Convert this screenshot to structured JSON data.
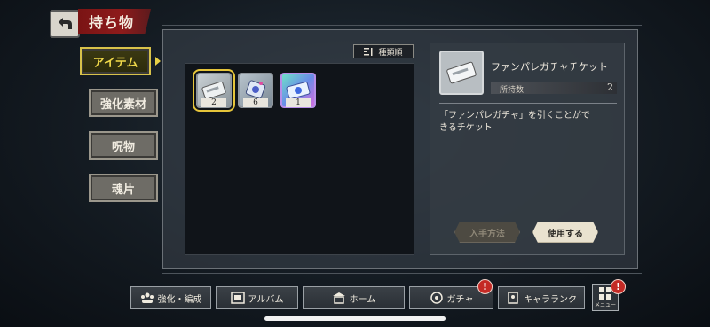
{
  "header": {
    "title": "持ち物"
  },
  "side_tabs": [
    {
      "label": "アイテム",
      "active": true
    },
    {
      "label": "強化素材",
      "active": false
    },
    {
      "label": "呪物",
      "active": false
    },
    {
      "label": "魂片",
      "active": false
    }
  ],
  "sort": {
    "icon": "sort-icon",
    "label": "種類順"
  },
  "items": [
    {
      "icon": "ticket-icon",
      "count": "2",
      "selected": true
    },
    {
      "icon": "tag-ticket-icon",
      "count": "6",
      "selected": false
    },
    {
      "icon": "rainbow-ticket-icon",
      "count": "1",
      "selected": false
    }
  ],
  "detail": {
    "name": "ファンパレガチャチケット",
    "owned_label": "所持数",
    "owned_value": "2",
    "description": "「ファンパレガチャ」を引くことがで\nきるチケット",
    "acquire_label": "入手方法",
    "use_label": "使用する"
  },
  "bottom_nav": [
    {
      "label": "強化・編成",
      "icon": "team-icon",
      "alert": false
    },
    {
      "label": "アルバム",
      "icon": "album-icon",
      "alert": false
    },
    {
      "label": "ホーム",
      "icon": "home-icon",
      "alert": false
    },
    {
      "label": "ガチャ",
      "icon": "gacha-icon",
      "alert": true
    },
    {
      "label": "キャラランク",
      "icon": "character-rank-icon",
      "alert": false
    }
  ],
  "menu": {
    "label": "メニュー",
    "alert": true,
    "alert_symbol": "!"
  },
  "colors": {
    "accent_gold": "#e6c53a",
    "banner_red": "#8e1b1b",
    "alert_red": "#c42a25"
  }
}
